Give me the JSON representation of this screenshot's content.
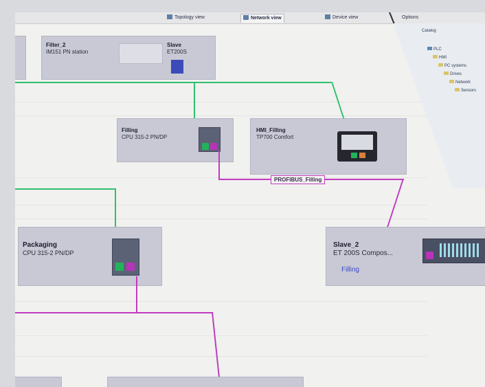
{
  "tabs": [
    {
      "label": "Topology view",
      "active": false
    },
    {
      "label": "Network view",
      "active": true
    },
    {
      "label": "Device view",
      "active": false
    },
    {
      "label": "Options",
      "active": false
    }
  ],
  "catalog": {
    "header": "Catalog",
    "items": [
      "PLC",
      "HMI",
      "PC systems",
      "Drives",
      "Network",
      "Sensors"
    ]
  },
  "devices": {
    "top_device": {
      "name": "Filter_2",
      "type": "IM151 PN station",
      "sub_name": "Slave",
      "sub_type": "ET200S"
    },
    "filling": {
      "name": "Filling",
      "type": "CPU 315-2 PN/DP"
    },
    "hmi": {
      "name": "HMI_Filling",
      "type": "TP700 Comfort"
    },
    "packaging": {
      "name": "Packaging",
      "type": "CPU 315-2 PN/DP"
    },
    "slave2": {
      "name": "Slave_2",
      "type": "ET 200S Compos...",
      "master": "Filling"
    }
  },
  "network_label": "PROFIBUS_Filling",
  "colors": {
    "profinet": "#2fbf6a",
    "profibus": "#c03ac0",
    "device": "#c8c9d5"
  }
}
